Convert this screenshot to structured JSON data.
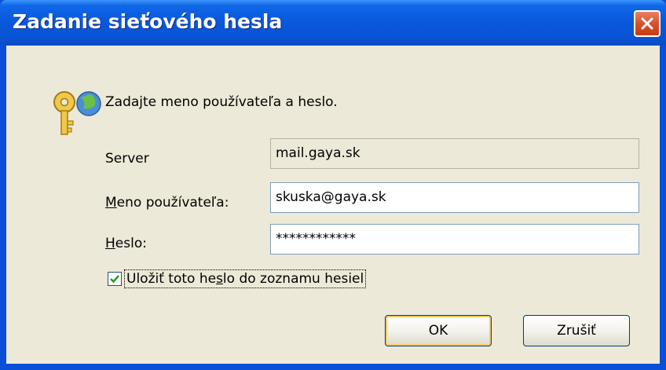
{
  "window": {
    "title": "Zadanie sieťového hesla",
    "close_icon": "close-icon"
  },
  "dialog": {
    "prompt": "Zadajte meno používateľa a heslo.",
    "icon": "key-globe-icon",
    "server_label": "Server",
    "server_value": "mail.gaya.sk",
    "username_label_key": "M",
    "username_label_rest": "eno používateľa:",
    "username_value": "skuska@gaya.sk",
    "password_label_key": "H",
    "password_label_rest": "eslo:",
    "password_value": "************",
    "remember_checked": true,
    "remember_label_pre": "Uložiť toto he",
    "remember_label_key": "s",
    "remember_label_post": "lo do zoznamu hesiel"
  },
  "buttons": {
    "ok": "OK",
    "cancel": "Zrušiť"
  },
  "colors": {
    "titlebar": "#0a58dd",
    "close_button": "#d9512a",
    "dialog_bg": "#ece9d8",
    "input_border": "#7f9db9",
    "default_button_highlight": "#f7c96a"
  }
}
